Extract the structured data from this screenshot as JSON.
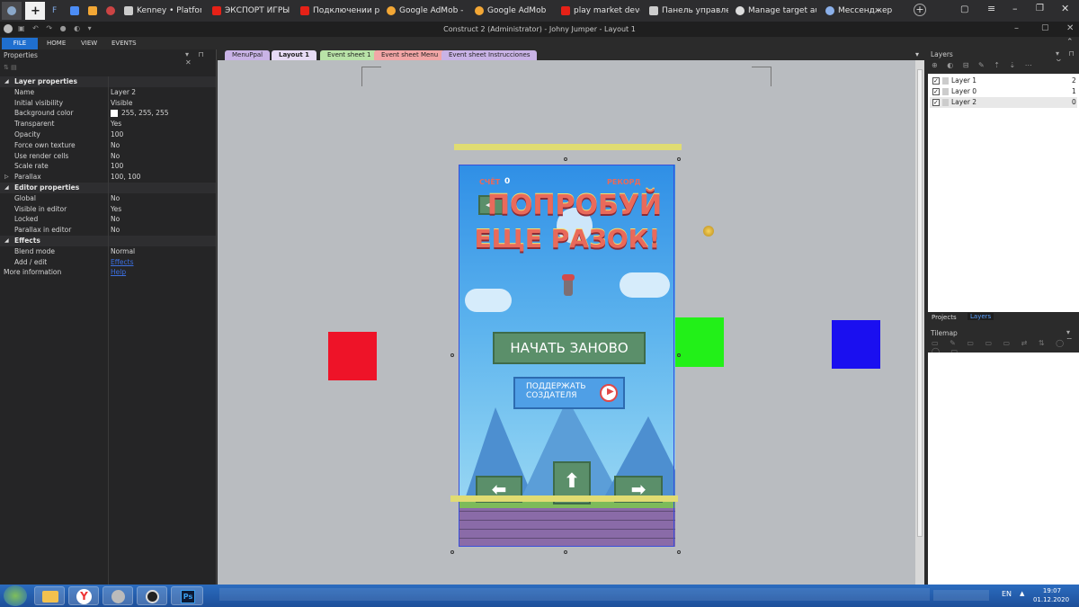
{
  "browser": {
    "tabs": [
      {
        "label": "",
        "icon": "user-icon"
      },
      {
        "label": "",
        "icon": "new-tab-icon"
      },
      {
        "label": "F",
        "icon": ""
      },
      {
        "label": "",
        "icon": "bookmark-icon"
      },
      {
        "label": "",
        "icon": "image-icon"
      },
      {
        "label": "",
        "icon": "app-icon"
      },
      {
        "label": "Kenney • Platforme",
        "icon": "kenney-icon"
      },
      {
        "label": "ЭКСПОРТ ИГРЫ Н",
        "icon": "youtube-icon"
      },
      {
        "label": "Подключении рек",
        "icon": "youtube-icon"
      },
      {
        "label": "Google AdMob - s",
        "icon": "google-icon"
      },
      {
        "label": "Google AdMob",
        "icon": "admob-icon"
      },
      {
        "label": "play market develo",
        "icon": "yandex-icon"
      },
      {
        "label": "Панель управлени",
        "icon": "play-icon"
      },
      {
        "label": "Manage target aud",
        "icon": "google-icon"
      },
      {
        "label": "Мессенджер",
        "icon": "messenger-icon"
      }
    ]
  },
  "window": {
    "title": "Construct 2 (Administrator) - Johny Jumper - Layout 1"
  },
  "ribbon": {
    "tabs": [
      "FILE",
      "HOME",
      "VIEW",
      "EVENTS"
    ]
  },
  "properties": {
    "title": "Properties",
    "rows": [
      {
        "k": "Layer properties",
        "v": "",
        "section": true
      },
      {
        "k": "Name",
        "v": "Layer 2"
      },
      {
        "k": "Initial visibility",
        "v": "Visible"
      },
      {
        "k": "Background color",
        "v": "255, 255, 255"
      },
      {
        "k": "Transparent",
        "v": "Yes"
      },
      {
        "k": "Opacity",
        "v": "100"
      },
      {
        "k": "Force own texture",
        "v": "No"
      },
      {
        "k": "Use render cells",
        "v": "No"
      },
      {
        "k": "Scale rate",
        "v": "100"
      },
      {
        "k": "Parallax",
        "v": "100, 100"
      },
      {
        "k": "Editor properties",
        "v": "",
        "section": true
      },
      {
        "k": "Global",
        "v": "No"
      },
      {
        "k": "Visible in editor",
        "v": "Yes"
      },
      {
        "k": "Locked",
        "v": "No"
      },
      {
        "k": "Parallax in editor",
        "v": "No"
      },
      {
        "k": "Effects",
        "v": "",
        "section": true
      },
      {
        "k": "Blend mode",
        "v": "Normal"
      },
      {
        "k": "Add / edit",
        "v": "Effects",
        "link": true
      },
      {
        "k": "More information",
        "v": "Help",
        "link": true
      }
    ]
  },
  "doc_tabs": [
    {
      "label": "MenuPpal",
      "color": "#c9b3e6"
    },
    {
      "label": "Layout 1",
      "color": "#c9b3e6"
    },
    {
      "label": "Event sheet 1",
      "color": "#b9e3a8"
    },
    {
      "label": "Event sheet Menu",
      "color": "#f2a6a6"
    },
    {
      "label": "Event sheet Instrucciones",
      "color": "#c9b3e6"
    }
  ],
  "game": {
    "score_label": "СЧЁТ",
    "score_value": "0",
    "record_label": "РЕКОРД",
    "headline_1": "ПОПРОБУЙ",
    "headline_2": "ЕЩЕ РАЗОК!",
    "restart_button": "НАЧАТЬ ЗАНОВО",
    "support_button_1": "ПОДДЕРЖАТЬ",
    "support_button_2": "СОЗДАТЕЛЯ"
  },
  "layers": {
    "title": "Layers",
    "rows": [
      {
        "name": "Layer 1",
        "index": "2"
      },
      {
        "name": "Layer 0",
        "index": "1"
      },
      {
        "name": "Layer 2",
        "index": "0"
      }
    ],
    "bottom_tabs": [
      "Projects",
      "Layers"
    ]
  },
  "tilemap": {
    "title": "Tilemap"
  },
  "taskbar": {
    "lang": "EN",
    "time": "19:07",
    "date": "01.12.2020"
  }
}
